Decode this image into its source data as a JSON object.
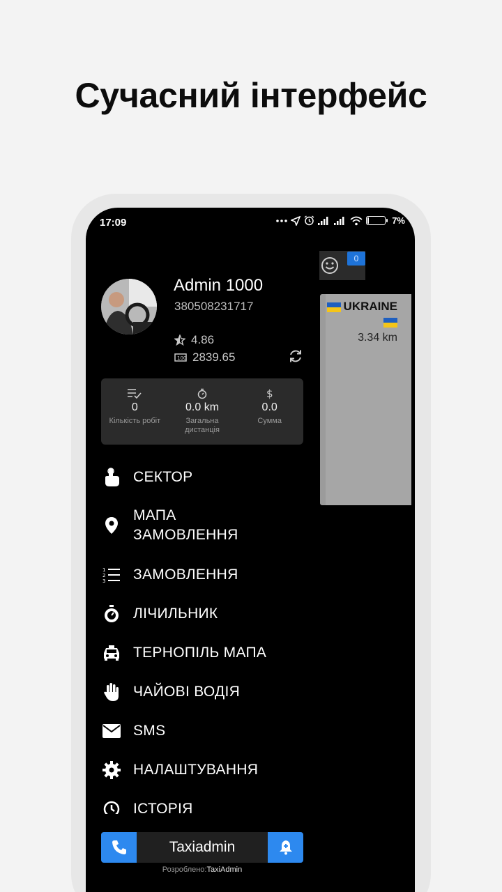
{
  "headline": "Сучасний інтерфейс",
  "status_bar": {
    "time": "17:09",
    "battery": "7"
  },
  "background": {
    "badge_count": "0",
    "order_card": {
      "country": "UKRAINE",
      "distance": "3.34 km"
    }
  },
  "profile": {
    "name": "Admin 1000",
    "phone": "380508231717",
    "rating": "4.86",
    "balance": "2839.65"
  },
  "stats": [
    {
      "icon": "checklist-icon",
      "value": "0",
      "label": "Кількість робіт"
    },
    {
      "icon": "timer-icon",
      "value": "0.0 km",
      "label": "Загальна дистанція"
    },
    {
      "icon": "dollar-icon",
      "value": "0.0",
      "label": "Сумма"
    }
  ],
  "menu": [
    {
      "icon": "hand-pointer-icon",
      "label": "СЕКТОР"
    },
    {
      "icon": "map-pin-icon",
      "label": "МАПА ЗАМОВЛЕННЯ"
    },
    {
      "icon": "numbered-list-icon",
      "label": "ЗАМОВЛЕННЯ"
    },
    {
      "icon": "stopwatch-icon",
      "label": "ЛІЧИЛЬНИК"
    },
    {
      "icon": "taxi-icon",
      "label": "ТЕРНОПІЛЬ МАПА"
    },
    {
      "icon": "hand-icon",
      "label": "ЧАЙОВІ ВОДІЯ"
    },
    {
      "icon": "envelope-icon",
      "label": "SMS"
    },
    {
      "icon": "gear-icon",
      "label": "НАЛАШТУВАННЯ"
    },
    {
      "icon": "history-icon",
      "label": "ІСТОРІЯ"
    }
  ],
  "bottom_bar": {
    "title": "Taxiadmin"
  },
  "credit": {
    "prefix": "Розроблено:",
    "brand": "TaxiAdmin"
  },
  "colors": {
    "accent": "#2d89ef",
    "drawer_bg": "#000000",
    "card_bg": "#2b2b2b"
  }
}
